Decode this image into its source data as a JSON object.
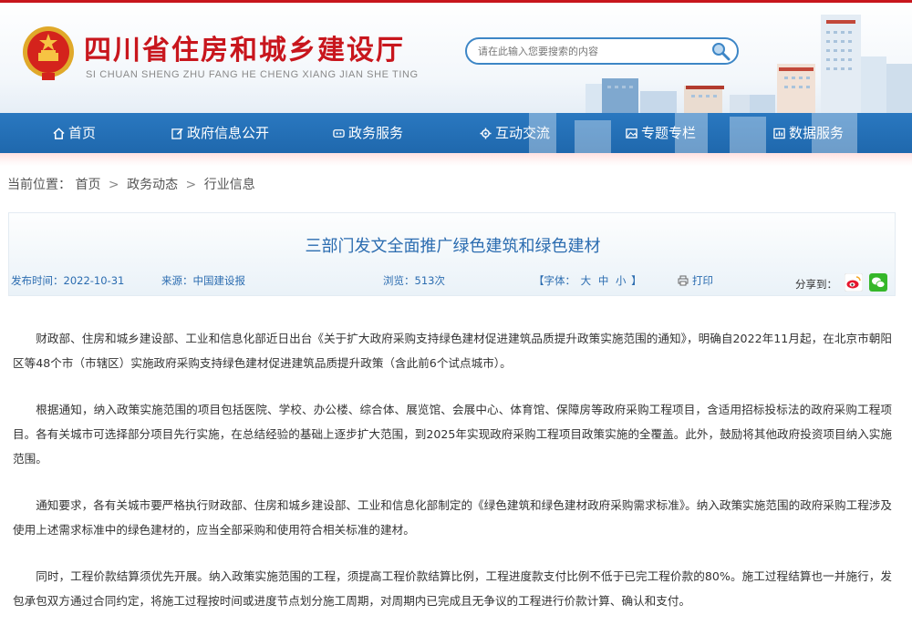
{
  "header": {
    "site_title": "四川省住房和城乡建设厅",
    "site_subtitle": "SI CHUAN SHENG ZHU FANG HE CHENG XIANG JIAN SHE TING",
    "emblem_icon": "national-emblem-icon",
    "search": {
      "placeholder": "请在此输入您要搜索的内容",
      "value": ""
    },
    "colors": {
      "brand_red": "#c8161d",
      "nav_blue": "#2a78c0"
    }
  },
  "nav": {
    "items": [
      {
        "label": "首页",
        "icon": "home-icon"
      },
      {
        "label": "政府信息公开",
        "icon": "edit-icon"
      },
      {
        "label": "政务服务",
        "icon": "service-icon"
      },
      {
        "label": "互动交流",
        "icon": "gear-icon"
      },
      {
        "label": "专题专栏",
        "icon": "image-icon"
      },
      {
        "label": "数据服务",
        "icon": "data-icon"
      }
    ]
  },
  "breadcrumb": {
    "prefix": "当前位置：",
    "items": [
      "首页",
      "政务动态",
      "行业信息"
    ],
    "separator": ">"
  },
  "article": {
    "title": "三部门发文全面推广绿色建筑和绿色建材",
    "publish_time": "发布时间：2022-10-31",
    "source": "来源：中国建设报",
    "views": "浏览：513次",
    "font_label_open": "【字体：",
    "font_sizes": [
      "大",
      "中",
      "小"
    ],
    "font_label_close": "】",
    "print_label": "打印",
    "share_label": "分享到：",
    "paragraphs": [
      "财政部、住房和城乡建设部、工业和信息化部近日出台《关于扩大政府采购支持绿色建材促进建筑品质提升政策实施范围的通知》，明确自2022年11月起，在北京市朝阳区等48个市（市辖区）实施政府采购支持绿色建材促进建筑品质提升政策（含此前6个试点城市）。",
      "根据通知，纳入政策实施范围的项目包括医院、学校、办公楼、综合体、展览馆、会展中心、体育馆、保障房等政府采购工程项目，含适用招标投标法的政府采购工程项目。各有关城市可选择部分项目先行实施，在总结经验的基础上逐步扩大范围，到2025年实现政府采购工程项目政策实施的全覆盖。此外，鼓励将其他政府投资项目纳入实施范围。",
      "通知要求，各有关城市要严格执行财政部、住房和城乡建设部、工业和信息化部制定的《绿色建筑和绿色建材政府采购需求标准》。纳入政策实施范围的政府采购工程涉及使用上述需求标准中的绿色建材的，应当全部采购和使用符合相关标准的建材。",
      "同时，工程价款结算须优先开展。纳入政策实施范围的工程，须提高工程价款结算比例，工程进度款支付比例不低于已完工程价款的80%。施工过程结算也一并施行，发包承包双方通过合同约定，将施工过程按时间或进度节点划分施工周期，对周期内已完成且无争议的工程进行价款计算、确认和支付。"
    ]
  }
}
